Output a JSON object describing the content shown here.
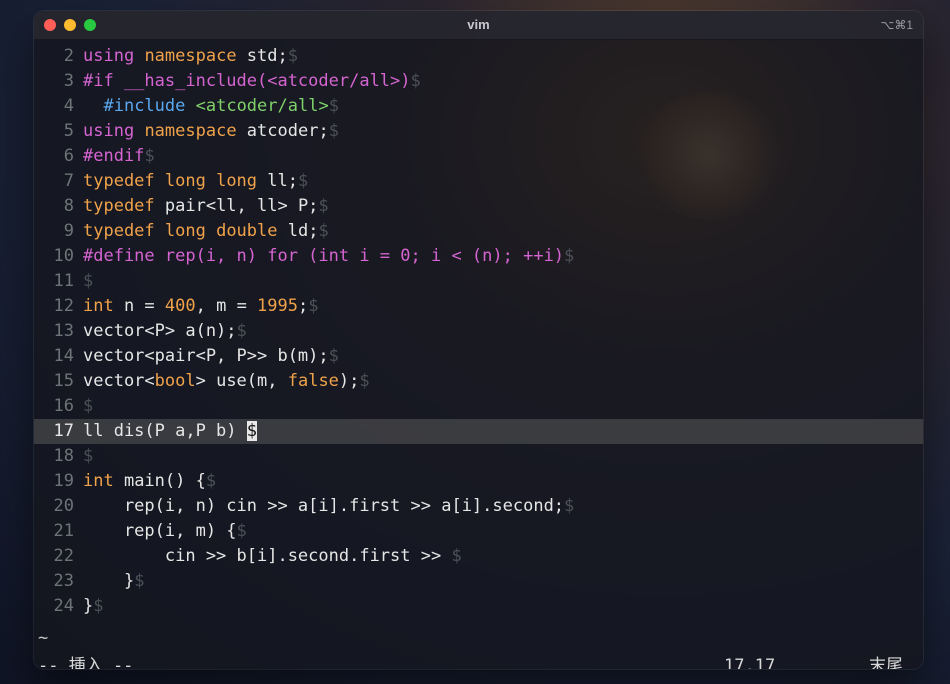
{
  "window": {
    "title": "vim",
    "shortcut": "⌥⌘1"
  },
  "editor": {
    "eol_marker": "$",
    "lines": [
      {
        "num": "2",
        "segments": [
          {
            "text": "using",
            "cls": "k"
          },
          {
            "text": " "
          },
          {
            "text": "namespace",
            "cls": "t"
          },
          {
            "text": " std;"
          },
          {
            "text": "$",
            "cls": "eol"
          }
        ]
      },
      {
        "num": "3",
        "segments": [
          {
            "text": "#if __has_include(<atcoder/all>)",
            "cls": "k"
          },
          {
            "text": "$",
            "cls": "eol"
          }
        ]
      },
      {
        "num": "4",
        "segments": [
          {
            "text": "  "
          },
          {
            "text": "#include",
            "cls": "i"
          },
          {
            "text": " "
          },
          {
            "text": "<atcoder/all>",
            "cls": "g"
          },
          {
            "text": "$",
            "cls": "eol"
          }
        ]
      },
      {
        "num": "5",
        "segments": [
          {
            "text": "using",
            "cls": "k"
          },
          {
            "text": " "
          },
          {
            "text": "namespace",
            "cls": "t"
          },
          {
            "text": " atcoder;"
          },
          {
            "text": "$",
            "cls": "eol"
          }
        ]
      },
      {
        "num": "6",
        "segments": [
          {
            "text": "#endif",
            "cls": "k"
          },
          {
            "text": "$",
            "cls": "eol"
          }
        ]
      },
      {
        "num": "7",
        "segments": [
          {
            "text": "typedef",
            "cls": "t"
          },
          {
            "text": " "
          },
          {
            "text": "long long",
            "cls": "t"
          },
          {
            "text": " ll;"
          },
          {
            "text": "$",
            "cls": "eol"
          }
        ]
      },
      {
        "num": "8",
        "segments": [
          {
            "text": "typedef",
            "cls": "t"
          },
          {
            "text": " pair<ll, ll> P;"
          },
          {
            "text": "$",
            "cls": "eol"
          }
        ]
      },
      {
        "num": "9",
        "segments": [
          {
            "text": "typedef",
            "cls": "t"
          },
          {
            "text": " "
          },
          {
            "text": "long double",
            "cls": "t"
          },
          {
            "text": " ld;"
          },
          {
            "text": "$",
            "cls": "eol"
          }
        ]
      },
      {
        "num": "10",
        "segments": [
          {
            "text": "#define rep(i, n) for (int i = 0; i < (n); ++i)",
            "cls": "k"
          },
          {
            "text": "$",
            "cls": "eol"
          }
        ]
      },
      {
        "num": "11",
        "segments": [
          {
            "text": "$",
            "cls": "eol"
          }
        ]
      },
      {
        "num": "12",
        "segments": [
          {
            "text": "int",
            "cls": "t"
          },
          {
            "text": " n = "
          },
          {
            "text": "400",
            "cls": "n"
          },
          {
            "text": ", m = "
          },
          {
            "text": "1995",
            "cls": "n"
          },
          {
            "text": ";"
          },
          {
            "text": "$",
            "cls": "eol"
          }
        ]
      },
      {
        "num": "13",
        "segments": [
          {
            "text": "vector<P> a(n);"
          },
          {
            "text": "$",
            "cls": "eol"
          }
        ]
      },
      {
        "num": "14",
        "segments": [
          {
            "text": "vector<pair<P, P>> b(m);"
          },
          {
            "text": "$",
            "cls": "eol"
          }
        ]
      },
      {
        "num": "15",
        "segments": [
          {
            "text": "vector<"
          },
          {
            "text": "bool",
            "cls": "t"
          },
          {
            "text": "> use(m, "
          },
          {
            "text": "false",
            "cls": "n"
          },
          {
            "text": ");"
          },
          {
            "text": "$",
            "cls": "eol"
          }
        ]
      },
      {
        "num": "16",
        "segments": [
          {
            "text": "$",
            "cls": "eol"
          }
        ]
      },
      {
        "num": "17",
        "current": true,
        "segments": [
          {
            "text": "ll dis(P a,P b) "
          },
          {
            "text": "$",
            "cls": "cursor"
          }
        ]
      },
      {
        "num": "18",
        "segments": [
          {
            "text": "$",
            "cls": "eol"
          }
        ]
      },
      {
        "num": "19",
        "segments": [
          {
            "text": "int",
            "cls": "t"
          },
          {
            "text": " main() {"
          },
          {
            "text": "$",
            "cls": "eol"
          }
        ]
      },
      {
        "num": "20",
        "segments": [
          {
            "text": "    rep(i, n) cin >> a[i].first >> a[i].second;"
          },
          {
            "text": "$",
            "cls": "eol"
          }
        ]
      },
      {
        "num": "21",
        "segments": [
          {
            "text": "    rep(i, m) {"
          },
          {
            "text": "$",
            "cls": "eol"
          }
        ]
      },
      {
        "num": "22",
        "segments": [
          {
            "text": "        cin >> b[i].second.first >> "
          },
          {
            "text": "$",
            "cls": "eol"
          }
        ]
      },
      {
        "num": "23",
        "segments": [
          {
            "text": "    }"
          },
          {
            "text": "$",
            "cls": "eol"
          }
        ]
      },
      {
        "num": "24",
        "segments": [
          {
            "text": "}"
          },
          {
            "text": "$",
            "cls": "eol"
          }
        ]
      }
    ],
    "tilde": "~"
  },
  "status": {
    "mode": "-- 挿入 --",
    "position": "17,17",
    "scroll": "末尾"
  },
  "colors": {
    "keyword": "#d564d1",
    "type": "#f0a24a",
    "include": "#5aa9f0",
    "string": "#7fd16a",
    "eol": "#4c5157"
  }
}
